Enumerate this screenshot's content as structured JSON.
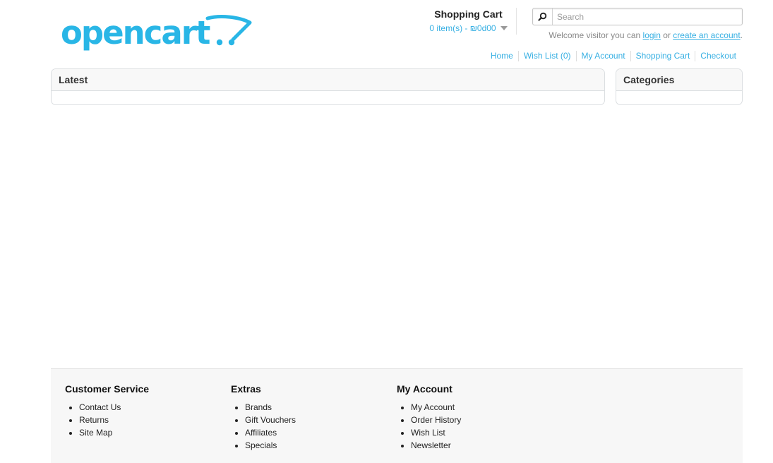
{
  "brand": {
    "logo_text": "opencart",
    "logo_color": "#29b6e6"
  },
  "colors": {
    "link": "#38b0e3",
    "heading": "#333333",
    "footer_bg": "#f7f7f7"
  },
  "cart": {
    "heading": "Shopping Cart",
    "total": "0 item(s) - ₪0d00"
  },
  "search": {
    "placeholder": "Search",
    "value": "",
    "icon": "search-icon"
  },
  "welcome": {
    "prefix": "Welcome visitor you can ",
    "login_label": "login",
    "middle": " or ",
    "register_label": "create an account",
    "suffix": "."
  },
  "top_links": [
    {
      "label": "Home"
    },
    {
      "label": "Wish List (0)"
    },
    {
      "label": "My Account"
    },
    {
      "label": "Shopping Cart"
    },
    {
      "label": "Checkout"
    }
  ],
  "boxes": {
    "latest": {
      "heading": "Latest"
    },
    "categories": {
      "heading": "Categories"
    }
  },
  "footer": {
    "columns": [
      {
        "heading": "Customer Service",
        "items": [
          "Contact Us",
          "Returns",
          "Site Map"
        ]
      },
      {
        "heading": "Extras",
        "items": [
          "Brands",
          "Gift Vouchers",
          "Affiliates",
          "Specials"
        ]
      },
      {
        "heading": "My Account",
        "items": [
          "My Account",
          "Order History",
          "Wish List",
          "Newsletter"
        ]
      }
    ]
  }
}
